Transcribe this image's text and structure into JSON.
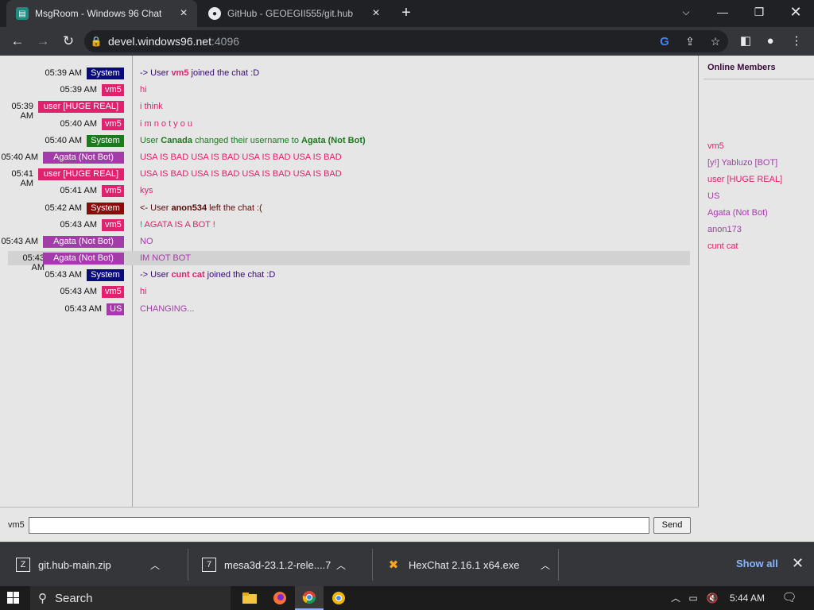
{
  "browser": {
    "tabs": [
      {
        "title": "MsgRoom - Windows 96 Chat",
        "active": true
      },
      {
        "title": "GitHub - GEOEGII555/git.hub",
        "active": false
      }
    ],
    "url_host": "devel.windows96.net",
    "url_port": ":4096"
  },
  "chat": {
    "messages": [
      {
        "time": "05:39 AM",
        "user": "System",
        "badge_color": "#0a0a80",
        "parts": [
          {
            "t": "-> User ",
            "c": "#3a0b6e"
          },
          {
            "t": "vm5",
            "c": "#e0226e",
            "b": true
          },
          {
            "t": " joined the chat :D",
            "c": "#3a0b6e"
          }
        ]
      },
      {
        "time": "05:39 AM",
        "user": "vm5",
        "badge_color": "#e0226e",
        "parts": [
          {
            "t": "hi",
            "c": "#e0226e"
          }
        ]
      },
      {
        "time": "05:39 AM",
        "user": "user [HUGE REAL]",
        "badge_color": "#e0226e",
        "parts": [
          {
            "t": "i think",
            "c": "#e0226e"
          }
        ]
      },
      {
        "time": "05:40 AM",
        "user": "vm5",
        "badge_color": "#e0226e",
        "parts": [
          {
            "t": "i m n o t y o u",
            "c": "#e0226e"
          }
        ]
      },
      {
        "time": "05:40 AM",
        "user": "System",
        "badge_color": "#1b7a1b",
        "parts": [
          {
            "t": "User ",
            "c": "#1b7a1b"
          },
          {
            "t": "Canada",
            "c": "#1b7a1b",
            "b": true
          },
          {
            "t": " changed their username to ",
            "c": "#1b7a1b"
          },
          {
            "t": "Agata (Not Bot)",
            "c": "#1b7a1b",
            "b": true
          }
        ]
      },
      {
        "time": "05:40 AM",
        "user": "Agata (Not Bot)",
        "badge_color": "#a23ca8",
        "parts": [
          {
            "t": "USA IS BAD USA IS BAD USA IS BAD USA IS BAD",
            "c": "#e0226e"
          }
        ]
      },
      {
        "time": "05:41 AM",
        "user": "user [HUGE REAL]",
        "badge_color": "#e0226e",
        "parts": [
          {
            "t": "USA IS BAD USA IS BAD USA IS BAD USA IS BAD",
            "c": "#e0226e"
          }
        ]
      },
      {
        "time": "05:41 AM",
        "user": "vm5",
        "badge_color": "#e0226e",
        "parts": [
          {
            "t": "kys",
            "c": "#e0226e"
          }
        ]
      },
      {
        "time": "05:42 AM",
        "user": "System",
        "badge_color": "#8b0a0a",
        "parts": [
          {
            "t": "<- User ",
            "c": "#5a0a0a"
          },
          {
            "t": "anon534",
            "c": "#5a0a0a",
            "b": true
          },
          {
            "t": " left the chat :(",
            "c": "#5a0a0a"
          }
        ]
      },
      {
        "time": "05:43 AM",
        "user": "vm5",
        "badge_color": "#e0226e",
        "parts": [
          {
            "t": "! AGATA IS A BOT !",
            "c": "#e0226e"
          }
        ]
      },
      {
        "time": "05:43 AM",
        "user": "Agata (Not Bot)",
        "badge_color": "#a23ca8",
        "parts": [
          {
            "t": "NO",
            "c": "#a23ca8"
          }
        ]
      },
      {
        "time": "05:43 AM",
        "user": "Agata (Not Bot)",
        "badge_color": "#a23ca8",
        "parts": [
          {
            "t": "IM NOT BOT",
            "c": "#a23ca8"
          }
        ],
        "highlight": true
      },
      {
        "time": "05:43 AM",
        "user": "System",
        "badge_color": "#0a0a80",
        "parts": [
          {
            "t": "-> User ",
            "c": "#3a0b6e"
          },
          {
            "t": "cunt cat",
            "c": "#e0226e",
            "b": true
          },
          {
            "t": " joined the chat :D",
            "c": "#3a0b6e"
          }
        ]
      },
      {
        "time": "05:43 AM",
        "user": "vm5",
        "badge_color": "#e0226e",
        "parts": [
          {
            "t": "hi",
            "c": "#e0226e"
          }
        ]
      },
      {
        "time": "05:43 AM",
        "user": "US",
        "badge_color": "#a23ca8",
        "parts": [
          {
            "t": "CHANGING...",
            "c": "#a23ca8"
          }
        ]
      }
    ],
    "input_label": "vm5",
    "input_value": "",
    "send_label": "Send"
  },
  "members": {
    "heading": "Online Members",
    "list": [
      {
        "name": "vm5",
        "color": "#e0226e"
      },
      {
        "name": "[y!] Yabluzo [BOT]",
        "color": "#a23ca8"
      },
      {
        "name": "user [HUGE REAL]",
        "color": "#e0226e"
      },
      {
        "name": "US",
        "color": "#a23ca8"
      },
      {
        "name": "Agata (Not Bot)",
        "color": "#a23ca8"
      },
      {
        "name": "anon173",
        "color": "#a23ca8"
      },
      {
        "name": "cunt cat",
        "color": "#e0226e"
      }
    ]
  },
  "downloads": {
    "items": [
      {
        "name": "git.hub-main.zip"
      },
      {
        "name": "mesa3d-23.1.2-rele....7z"
      },
      {
        "name": "HexChat 2.16.1 x64.exe"
      }
    ],
    "show_all": "Show all"
  },
  "taskbar": {
    "search_label": "Search",
    "time": "5:44 AM"
  }
}
